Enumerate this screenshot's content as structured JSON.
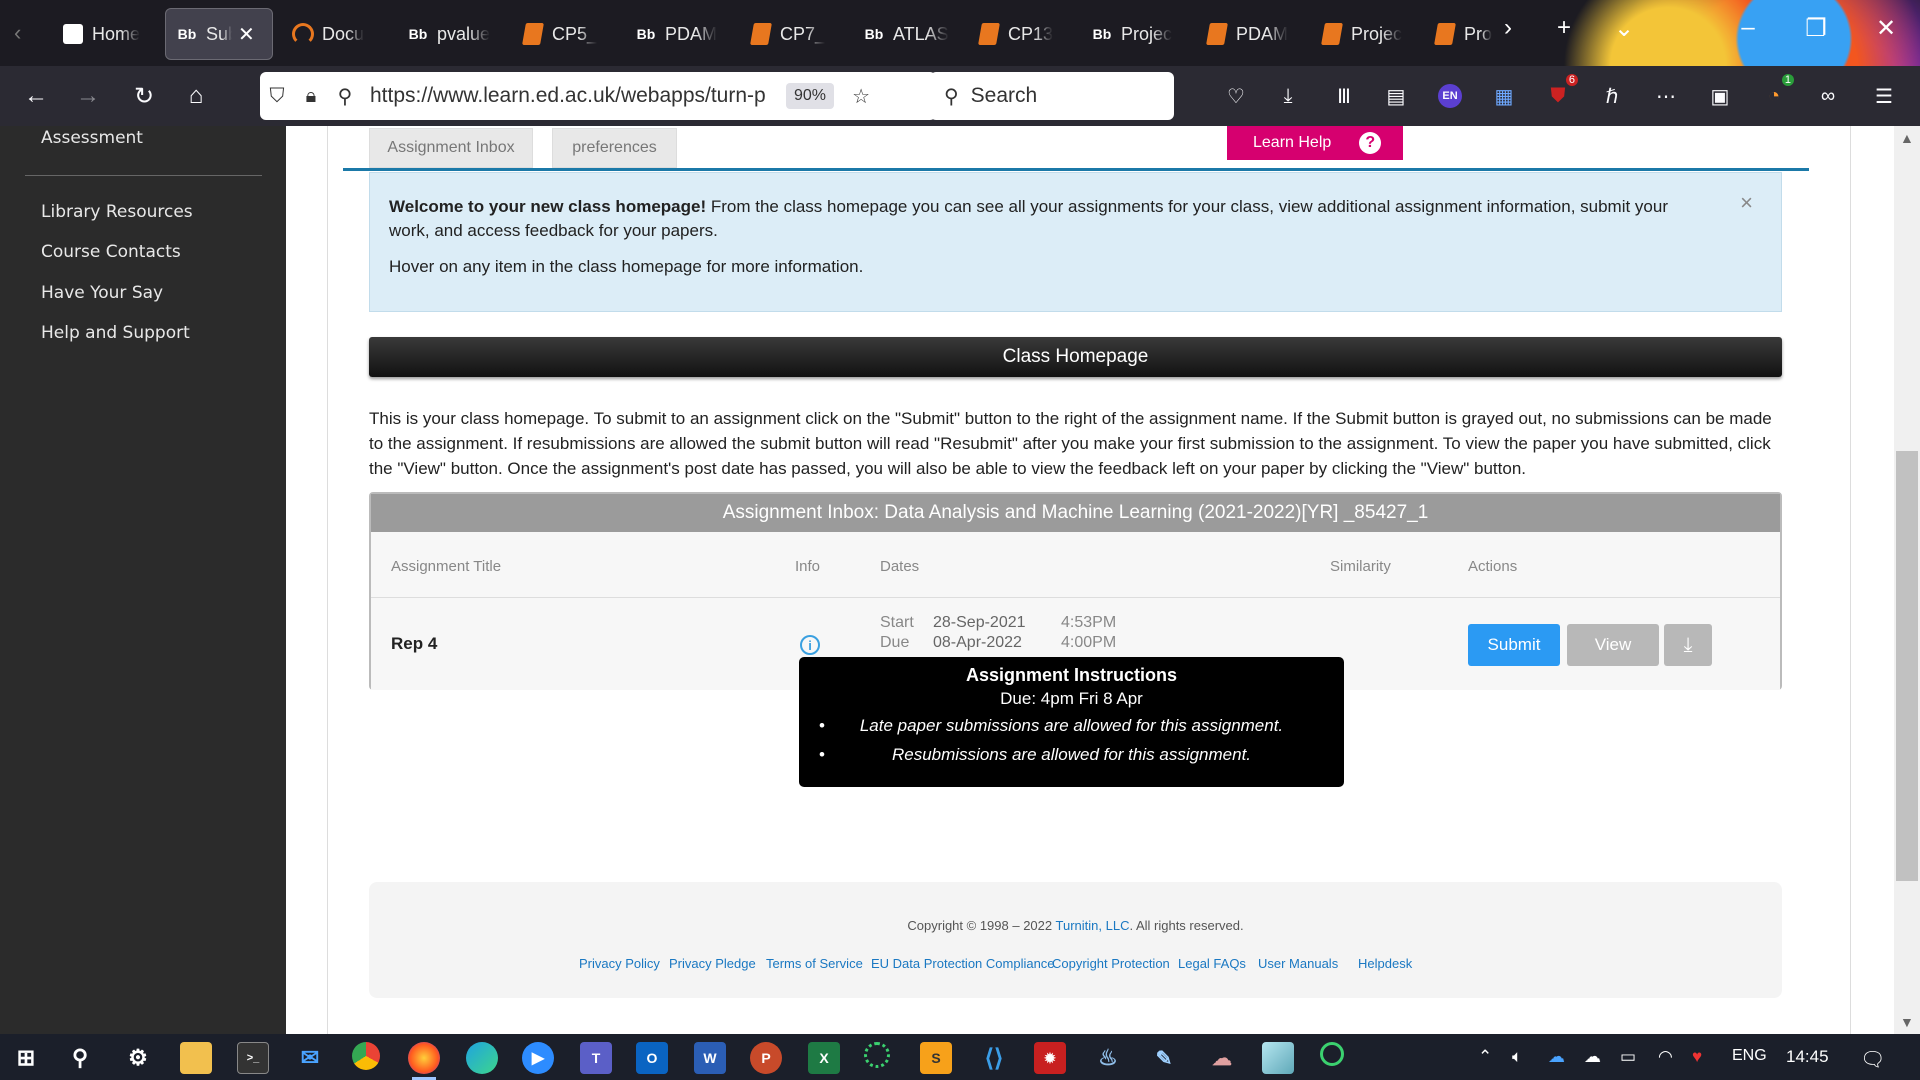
{
  "browser": {
    "tabs": [
      {
        "title": "Home",
        "icon": "ed-crest-icon"
      },
      {
        "title": "Sub",
        "icon": "bb-icon",
        "active": true
      },
      {
        "title": "Docu",
        "icon": "swirl-icon"
      },
      {
        "title": "pvalue",
        "icon": "bb-icon"
      },
      {
        "title": "CP5_",
        "icon": "document-icon"
      },
      {
        "title": "PDAM",
        "icon": "bb-icon"
      },
      {
        "title": "CP7_",
        "icon": "document-icon"
      },
      {
        "title": "ATLAS",
        "icon": "bb-icon"
      },
      {
        "title": "CP13",
        "icon": "document-icon"
      },
      {
        "title": "Projec",
        "icon": "bb-icon"
      },
      {
        "title": "PDAM",
        "icon": "document-icon"
      },
      {
        "title": "Projec",
        "icon": "document-icon"
      },
      {
        "title": "Pro",
        "icon": "document-icon"
      }
    ],
    "bb_glyph": "Bb",
    "url": "https://www.learn.ed.ac.uk/webapps/turn-p",
    "zoom": "90%",
    "search_placeholder": "Search",
    "badges": {
      "ublock": "6",
      "extension": "1"
    },
    "lang_badge": "EN"
  },
  "sidebar": {
    "items": [
      "Assessment",
      "Library Resources",
      "Course Contacts",
      "Have Your Say",
      "Help and Support"
    ]
  },
  "page": {
    "tabs": [
      "Assignment Inbox",
      "preferences"
    ],
    "learn_help": "Learn Help",
    "learn_help_icon": "?",
    "welcome": {
      "bold": "Welcome to your new class homepage!",
      "text": " From the class homepage you can see all your assignments for your class, view additional assignment information, submit your work, and access feedback for your papers.",
      "hover": "Hover on any item in the class homepage for more information.",
      "close": "×"
    },
    "class_homepage": "Class Homepage",
    "intro": "This is your class homepage. To submit to an assignment click on the \"Submit\" button to the right of the assignment name. If the Submit button is grayed out, no submissions can be made to the assignment. If resubmissions are allowed the submit button will read \"Resubmit\" after you make your first submission to the assignment. To view the paper you have submitted, click the \"View\" button. Once the assignment's post date has passed, you will also be able to view the feedback left on your paper by clicking the \"View\" button.",
    "inbox": {
      "title": "Assignment Inbox: Data Analysis and Machine Learning (2021-2022)[YR] _85427_1",
      "columns": [
        "Assignment Title",
        "Info",
        "Dates",
        "Similarity",
        "Actions"
      ],
      "row": {
        "title": "Rep 4",
        "start_label": "Start",
        "start_date": "28-Sep-2021",
        "start_time": "4:53PM",
        "due_label": "Due",
        "due_date": "08-Apr-2022",
        "due_time": "4:00PM",
        "submit": "Submit",
        "view": "View"
      }
    },
    "tooltip": {
      "title": "Assignment Instructions",
      "due": "Due: 4pm Fri 8 Apr",
      "items": [
        "Late paper submissions are allowed for this assignment.",
        "Resubmissions are allowed for this assignment."
      ]
    },
    "footer": {
      "copyright_prefix": "Copyright © 1998 – 2022 ",
      "copyright_link": "Turnitin, LLC",
      "copyright_suffix": ". All rights reserved.",
      "links": [
        "Privacy Policy",
        "Privacy Pledge",
        "Terms of Service",
        "EU Data Protection Compliance",
        "Copyright Protection",
        "Legal FAQs",
        "User Manuals",
        "Helpdesk"
      ]
    }
  },
  "taskbar": {
    "lang": "ENG",
    "time": "14:45"
  }
}
